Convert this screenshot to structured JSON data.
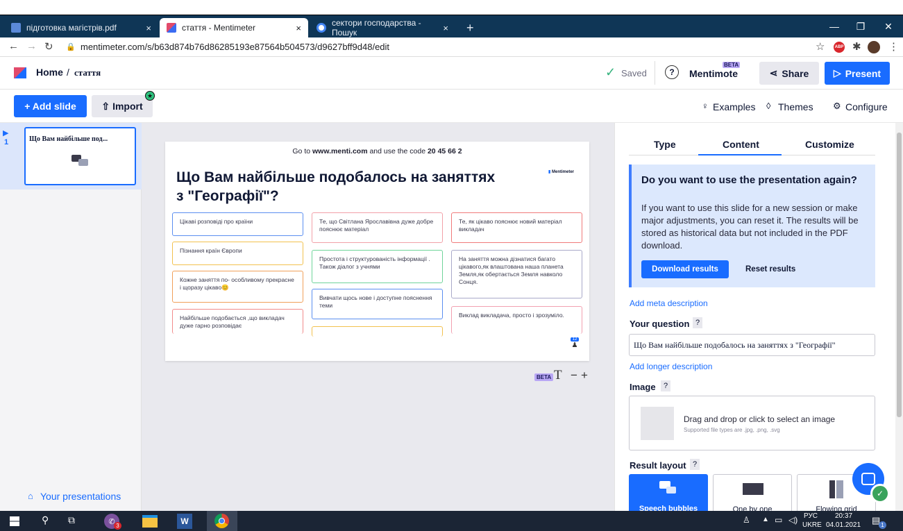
{
  "browser": {
    "tabs": [
      {
        "title": "підготовка магістрів.pdf",
        "close": "×"
      },
      {
        "title": "стаття - Mentimeter",
        "close": "×"
      },
      {
        "title": "сектори господарства - Пошук",
        "close": "×"
      }
    ],
    "new_tab": "+",
    "url": "mentimeter.com/s/b63d874b76d86285193e87564b504573/d9627bff9d48/edit",
    "ext_abp": "ABP"
  },
  "header": {
    "home": "Home",
    "separator": "/",
    "title": "стаття",
    "saved": "Saved",
    "mentimote": "Mentimote",
    "beta": "BETA",
    "share": "Share",
    "present": "Present"
  },
  "toolbar": {
    "add_slide": "+ Add slide",
    "import": "Import",
    "examples": "Examples",
    "themes": "Themes",
    "configure": "Configure"
  },
  "sidebar": {
    "slide_number": "1",
    "slide_title": "Що Вам найбільше под...",
    "your_presentations": "Your presentations"
  },
  "slide": {
    "instruction_prefix": "Go to",
    "instruction_site": "www.menti.com",
    "instruction_mid": "and use the code",
    "code": "20 45 66 2",
    "brand": "Mentimeter",
    "question": "Що Вам найбільше подобалось на заняттях з \"Географії\"?",
    "counter": "12",
    "bubbles": [
      {
        "text": "Цікаві розповіді про країни",
        "color": "#5a8ef0"
      },
      {
        "text": "Пізнання країн Європи",
        "color": "#f2c14e"
      },
      {
        "text": "Кожне заняття по- особливому прекрасне і щоразу цікаво😊",
        "color": "#f0a05a"
      },
      {
        "text": "Найбільше подобається ,що викладач дуже гарно розповідає",
        "color": "#f28b8b"
      },
      {
        "text": "Те, що Світлана Ярославівна дуже добре пояснює матеріал",
        "color": "#f2a0a8"
      },
      {
        "text": "Простота і структурованість інформації . Також діалог з учнями",
        "color": "#6fd49a"
      },
      {
        "text": "Вивчати щось нове і доступне пояснення теми",
        "color": "#5a8ef0"
      },
      {
        "text": "",
        "color": "#f2c14e"
      },
      {
        "text": "Те, як цікаво пояснює новий матеріал викладач",
        "color": "#f07a7a"
      },
      {
        "text": "На заняття можна дізнатися багато цікавого,як влаштована наша планета Земля,як обертається Земля навколо Сонця.",
        "color": "#a9a9c9"
      },
      {
        "text": "Виклад викладача, просто і зрозуміло.",
        "color": "#f2a0b0"
      }
    ],
    "beta": "BETA",
    "text_tool": "T",
    "minus": "−",
    "plus": "+"
  },
  "panel": {
    "tabs": [
      "Type",
      "Content",
      "Customize"
    ],
    "active_tab": "Content",
    "notice_title": "Do you want to use the presentation again?",
    "notice_body": "If you want to use this slide for a new session or make major adjustments, you can reset it. The results will be stored as historical data but not included in the PDF download.",
    "download": "Download results",
    "reset": "Reset results",
    "add_meta": "Add meta description",
    "your_question": "Your question",
    "question_value": "Що Вам найбільше подобалось на заняттях з \"Географії\"",
    "add_longer": "Add longer description",
    "image_label": "Image",
    "drag_drop": "Drag and drop or click to select an image",
    "supported": "Supported file types are .jpg, .png, .svg",
    "result_layout": "Result layout",
    "help": "?",
    "layouts": [
      "Speech bubbles",
      "One by one",
      "Flowing grid"
    ]
  },
  "taskbar": {
    "viber_badge": "3",
    "lang": "РУС",
    "lang2": "UKRE",
    "time": "20:37",
    "date": "04.01.2021",
    "notif": "1"
  },
  "colors": {
    "accent": "#196cff",
    "notice_bg": "#dce8fd",
    "notice_border": "#3d7cff",
    "tab_bar": "#0f3656",
    "taskbar": "#1b2535",
    "green": "#36b37e"
  }
}
